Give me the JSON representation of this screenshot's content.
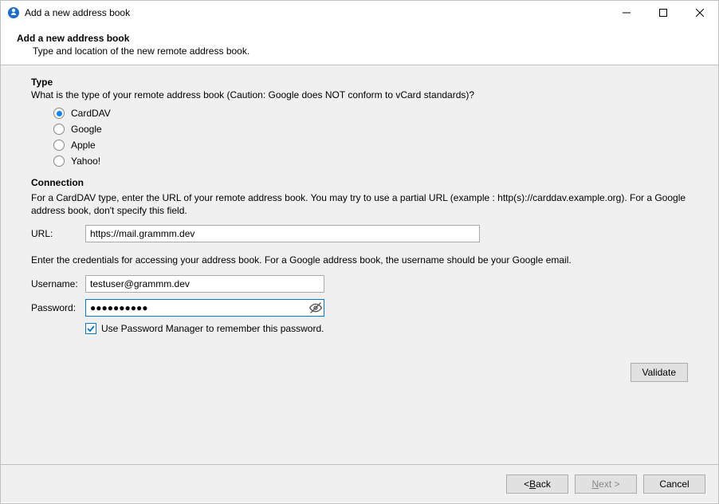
{
  "window": {
    "title": "Add a new address book"
  },
  "header": {
    "title": "Add a new address book",
    "subtitle": "Type and location of the new remote address book."
  },
  "type_section": {
    "title": "Type",
    "description": "What is the type of your remote address book (Caution: Google does NOT conform to vCard standards)?",
    "options": [
      {
        "label": "CardDAV",
        "selected": true
      },
      {
        "label": "Google",
        "selected": false
      },
      {
        "label": "Apple",
        "selected": false
      },
      {
        "label": "Yahoo!",
        "selected": false
      }
    ]
  },
  "connection_section": {
    "title": "Connection",
    "description": "For a CardDAV type, enter the URL of your remote address book. You may try to use a partial URL (example : http(s)://carddav.example.org). For a Google address book, don't specify this field.",
    "url_label": "URL:",
    "url_value": "https://mail.grammm.dev"
  },
  "credentials": {
    "intro": "Enter the credentials for accessing your address book. For a Google address book, the username should be your Google email.",
    "username_label": "Username:",
    "username_value": "testuser@grammm.dev",
    "password_label": "Password:",
    "password_value": "●●●●●●●●●●",
    "remember_label": "Use Password Manager to remember this password.",
    "remember_checked": true
  },
  "buttons": {
    "validate": "Validate",
    "back_prefix": "< ",
    "back_letter": "B",
    "back_rest": "ack",
    "next_letter": "N",
    "next_rest": "ext >",
    "cancel": "Cancel"
  }
}
